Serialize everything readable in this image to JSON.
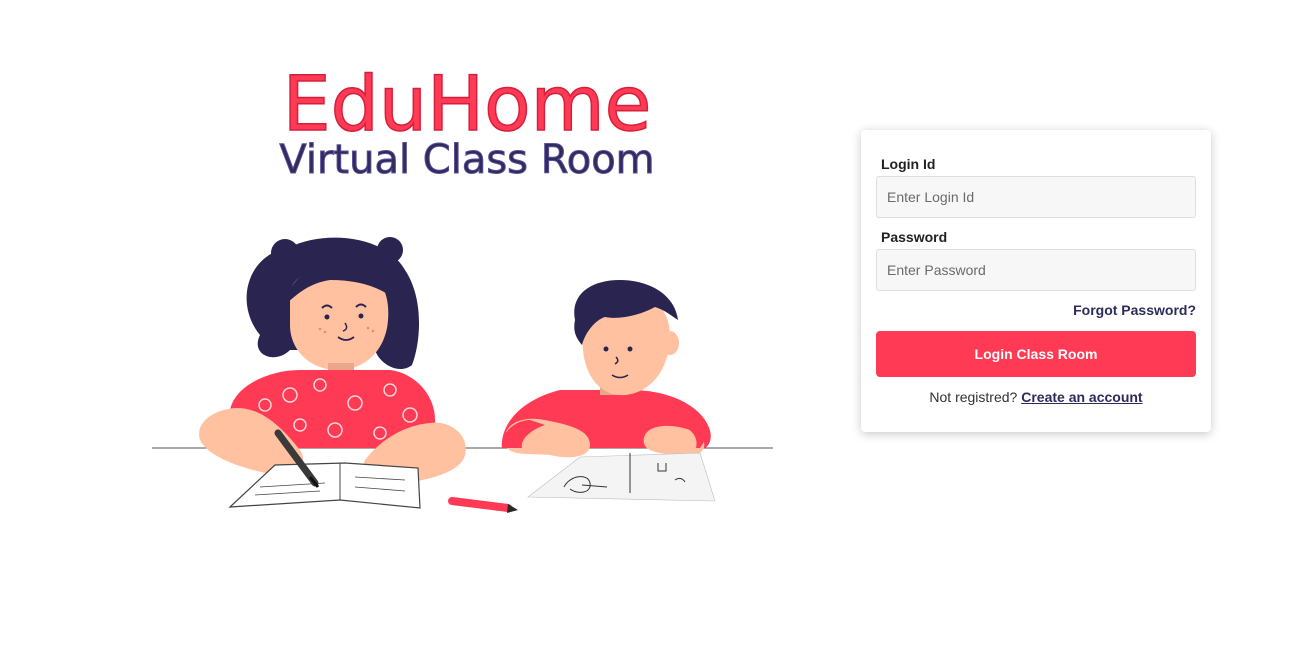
{
  "brand": {
    "title": "EduHome",
    "subtitle": "Virtual Class Room"
  },
  "illustration": {
    "alt": "illustration-kids-studying"
  },
  "login_form": {
    "login_id_label": "Login Id",
    "login_id_placeholder": "Enter Login Id",
    "login_id_value": "",
    "password_label": "Password",
    "password_placeholder": "Enter Password",
    "password_value": "",
    "forgot_password": "Forgot Password?",
    "submit_label": "Login Class Room",
    "register_prompt": "Not registred?",
    "register_link": "Create an account"
  },
  "colors": {
    "accent": "#ff3a55",
    "navy": "#2c2c5a",
    "input_bg": "#f7f7f7"
  }
}
